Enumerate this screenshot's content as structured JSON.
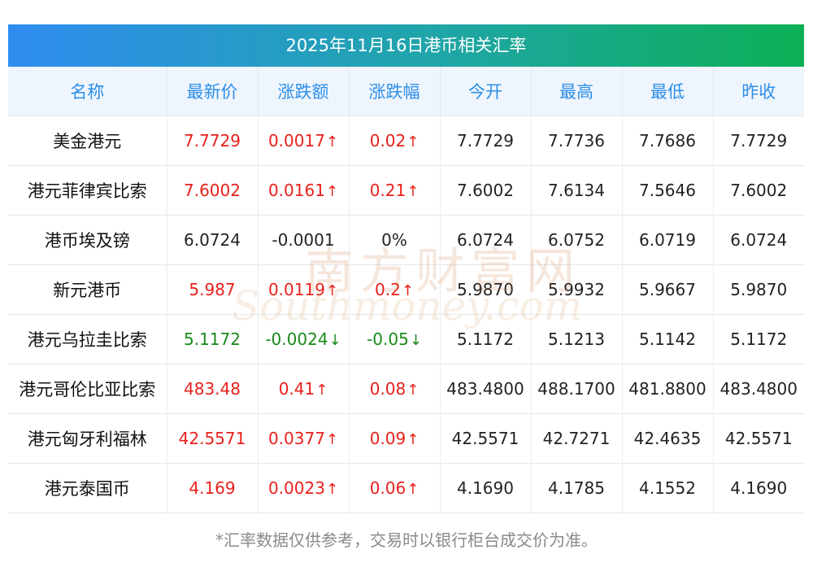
{
  "title": "2025年11月16日港币相关汇率",
  "columns": [
    "名称",
    "最新价",
    "涨跌额",
    "涨跌幅",
    "今开",
    "最高",
    "最低",
    "昨收"
  ],
  "rows": [
    {
      "name": "美金港元",
      "latest": "7.7729",
      "change": "0.0017",
      "pct": "0.02",
      "dir": "up",
      "open": "7.7729",
      "high": "7.7736",
      "low": "7.7686",
      "prev": "7.7729"
    },
    {
      "name": "港元菲律宾比索",
      "latest": "7.6002",
      "change": "0.0161",
      "pct": "0.21",
      "dir": "up",
      "open": "7.6002",
      "high": "7.6134",
      "low": "7.5646",
      "prev": "7.6002"
    },
    {
      "name": "港币埃及镑",
      "latest": "6.0724",
      "change": "-0.0001",
      "pct": "0%",
      "dir": "flat",
      "open": "6.0724",
      "high": "6.0752",
      "low": "6.0719",
      "prev": "6.0724"
    },
    {
      "name": "新元港币",
      "latest": "5.987",
      "change": "0.0119",
      "pct": "0.2",
      "dir": "up",
      "open": "5.9870",
      "high": "5.9932",
      "low": "5.9667",
      "prev": "5.9870"
    },
    {
      "name": "港元乌拉圭比索",
      "latest": "5.1172",
      "change": "-0.0024",
      "pct": "-0.05",
      "dir": "down",
      "open": "5.1172",
      "high": "5.1213",
      "low": "5.1142",
      "prev": "5.1172"
    },
    {
      "name": "港元哥伦比亚比索",
      "latest": "483.48",
      "change": "0.41",
      "pct": "0.08",
      "dir": "up",
      "open": "483.4800",
      "high": "488.1700",
      "low": "481.8800",
      "prev": "483.4800"
    },
    {
      "name": "港元匈牙利福林",
      "latest": "42.5571",
      "change": "0.0377",
      "pct": "0.09",
      "dir": "up",
      "open": "42.5571",
      "high": "42.7271",
      "low": "42.4635",
      "prev": "42.5571"
    },
    {
      "name": "港元泰国币",
      "latest": "4.169",
      "change": "0.0023",
      "pct": "0.06",
      "dir": "up",
      "open": "4.1690",
      "high": "4.1785",
      "low": "4.1552",
      "prev": "4.1690"
    }
  ],
  "arrows": {
    "up": "↑",
    "down": "↓",
    "flat": ""
  },
  "colors": {
    "up": "#e8211c",
    "down": "#1a8a1a",
    "header_text": "#2d8ee8",
    "title_gradient_start": "#2f8cf0",
    "title_gradient_end": "#0daf55"
  },
  "watermark": {
    "cn": "南方财富网",
    "en": "Southmoney.com"
  },
  "footnote": "*汇率数据仅供参考，交易时以银行柜台成交价为准。"
}
